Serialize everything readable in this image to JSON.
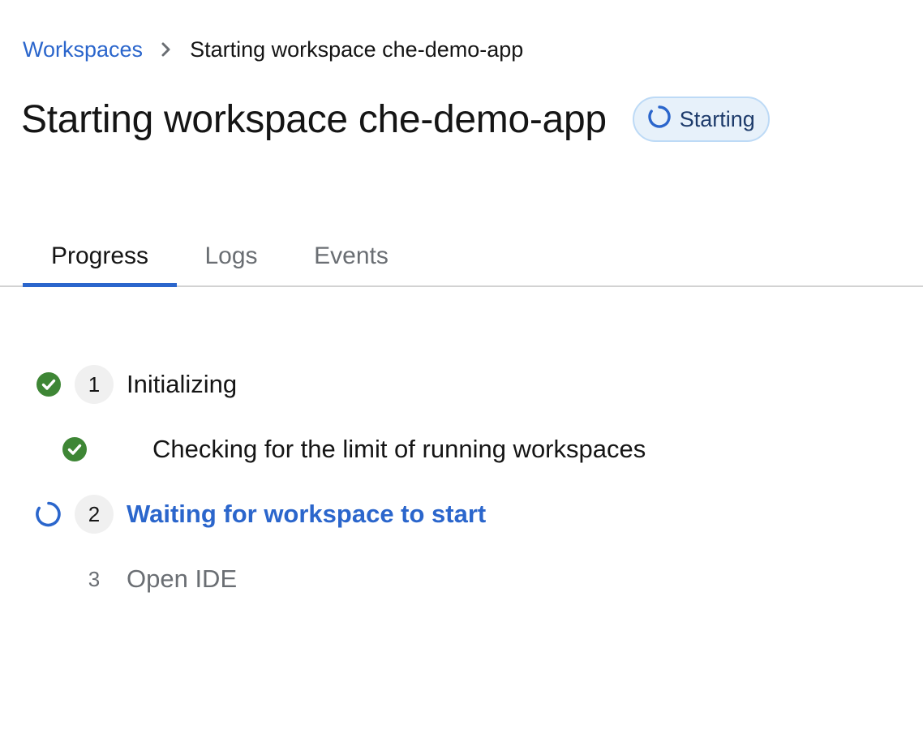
{
  "breadcrumb": {
    "root_label": "Workspaces",
    "current_label": "Starting workspace che-demo-app"
  },
  "header": {
    "title": "Starting workspace che-demo-app",
    "status": "Starting"
  },
  "tabs": [
    {
      "label": "Progress",
      "active": true
    },
    {
      "label": "Logs",
      "active": false
    },
    {
      "label": "Events",
      "active": false
    }
  ],
  "steps": [
    {
      "number": "1",
      "label": "Initializing",
      "state": "done"
    },
    {
      "number": "",
      "label": "Checking for the limit of running workspaces",
      "state": "done"
    },
    {
      "number": "2",
      "label": "Waiting for workspace to start",
      "state": "in-progress"
    },
    {
      "number": "3",
      "label": "Open IDE",
      "state": "pending"
    }
  ],
  "colors": {
    "accent": "#2b66cc",
    "success": "#3e8635",
    "badge_bg": "#e7f1fa",
    "muted": "#6a6e73"
  },
  "icons": {
    "breadcrumb_separator": "chevron-right-icon",
    "status": "spinner-icon",
    "done": "check-circle-icon",
    "in_progress": "spinner-icon"
  }
}
